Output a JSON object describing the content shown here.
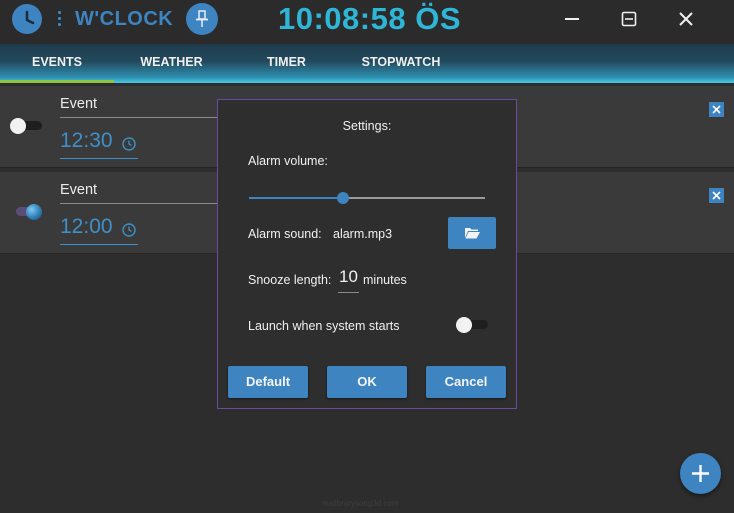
{
  "app": {
    "title": "W'CLOCK",
    "current_time": "10:08:58 ÖS",
    "accent_color": "#3d84c0",
    "clock_color": "#2fb6d6"
  },
  "window_controls": [
    "minimize-icon",
    "maximize-icon",
    "close-icon"
  ],
  "tabs": [
    {
      "label": "EVENTS",
      "active": true
    },
    {
      "label": "WEATHER",
      "active": false
    },
    {
      "label": "TIMER",
      "active": false
    },
    {
      "label": "STOPWATCH",
      "active": false
    }
  ],
  "events": [
    {
      "name": "Event",
      "time": "12:30",
      "enabled": false
    },
    {
      "name": "Event",
      "time": "12:00",
      "enabled": true
    }
  ],
  "settings": {
    "title": "Settings:",
    "volume_label": "Alarm volume:",
    "volume_level": 0.4,
    "sound_label": "Alarm sound:",
    "sound_file": "alarm.mp3",
    "snooze_label": "Snooze length:",
    "snooze_value": "10",
    "snooze_unit": "minutes",
    "launch_label": "Launch when system starts",
    "launch_enabled": false,
    "buttons": {
      "default": "Default",
      "ok": "OK",
      "cancel": "Cancel"
    }
  },
  "fab_icon": "plus-icon",
  "watermark": "malibrarysong3d.com"
}
